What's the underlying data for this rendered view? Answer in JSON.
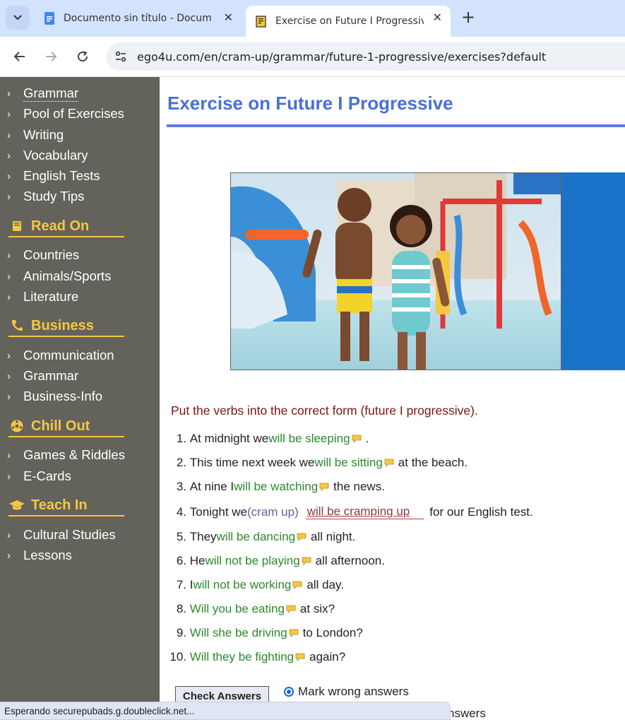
{
  "browser": {
    "tabs": [
      {
        "label": "Documento sin título - Docume",
        "active": false,
        "icon": "google-docs-icon"
      },
      {
        "label": "Exercise on Future I Progressive",
        "active": true,
        "icon": "ego4u-favicon"
      }
    ],
    "close_glyph": "✕",
    "new_tab_glyph": "+",
    "url": "ego4u.com/en/cram-up/grammar/future-1-progressive/exercises?default",
    "accent_color": "#d3e3fd"
  },
  "sidebar": {
    "background": "#63635b",
    "heading_color": "#f5c842",
    "top_items": [
      "Grammar",
      "Pool of Exercises",
      "Writing",
      "Vocabulary",
      "English Tests",
      "Study Tips"
    ],
    "sections": [
      {
        "title": "Read On",
        "icon": "book-icon",
        "items": [
          "Countries",
          "Animals/Sports",
          "Literature"
        ]
      },
      {
        "title": "Business",
        "icon": "phone-icon",
        "items": [
          "Communication",
          "Grammar",
          "Business-Info"
        ]
      },
      {
        "title": "Chill Out",
        "icon": "football-icon",
        "items": [
          "Games & Riddles",
          "E-Cards"
        ]
      },
      {
        "title": "Teach In",
        "icon": "graduation-cap-icon",
        "items": [
          "Cultural Studies",
          "Lessons"
        ]
      }
    ]
  },
  "main": {
    "title": "Exercise on Future I Progressive",
    "instructions": "Put the verbs into the correct form (future I progressive).",
    "exercises": [
      {
        "num": "1.",
        "before": "At midnight we ",
        "answer": "will be sleeping",
        "after": " ."
      },
      {
        "num": "2.",
        "before": "This time next week we ",
        "answer": "will be sitting",
        "after": " at the beach."
      },
      {
        "num": "3.",
        "before": "At nine I ",
        "answer": "will be watching",
        "after": " the news."
      },
      {
        "num": "4.",
        "before": "Tonight we ",
        "hint": "(cram up)",
        "wrong_answer": "will be cramping up",
        "after": " for our English test."
      },
      {
        "num": "5.",
        "before": "They ",
        "answer": "will be dancing",
        "after": " all night."
      },
      {
        "num": "6.",
        "before": "He ",
        "answer": "will not be playing",
        "after": " all afternoon."
      },
      {
        "num": "7.",
        "before": "I ",
        "answer": "will not be working",
        "after": " all day."
      },
      {
        "num": "8.",
        "before": "",
        "answer": "Will you be eating",
        "after": " at six?"
      },
      {
        "num": "9.",
        "before": "",
        "answer": "Will she be driving",
        "after": " to London?"
      },
      {
        "num": "10.",
        "before": "",
        "answer": "Will they be fighting",
        "after": " again?"
      }
    ],
    "check_button": "Check Answers",
    "radio_mark_wrong": "Mark wrong answers",
    "radio_second_partial": "nswers"
  },
  "status": "Esperando securepubads.g.doubleclick.net..."
}
